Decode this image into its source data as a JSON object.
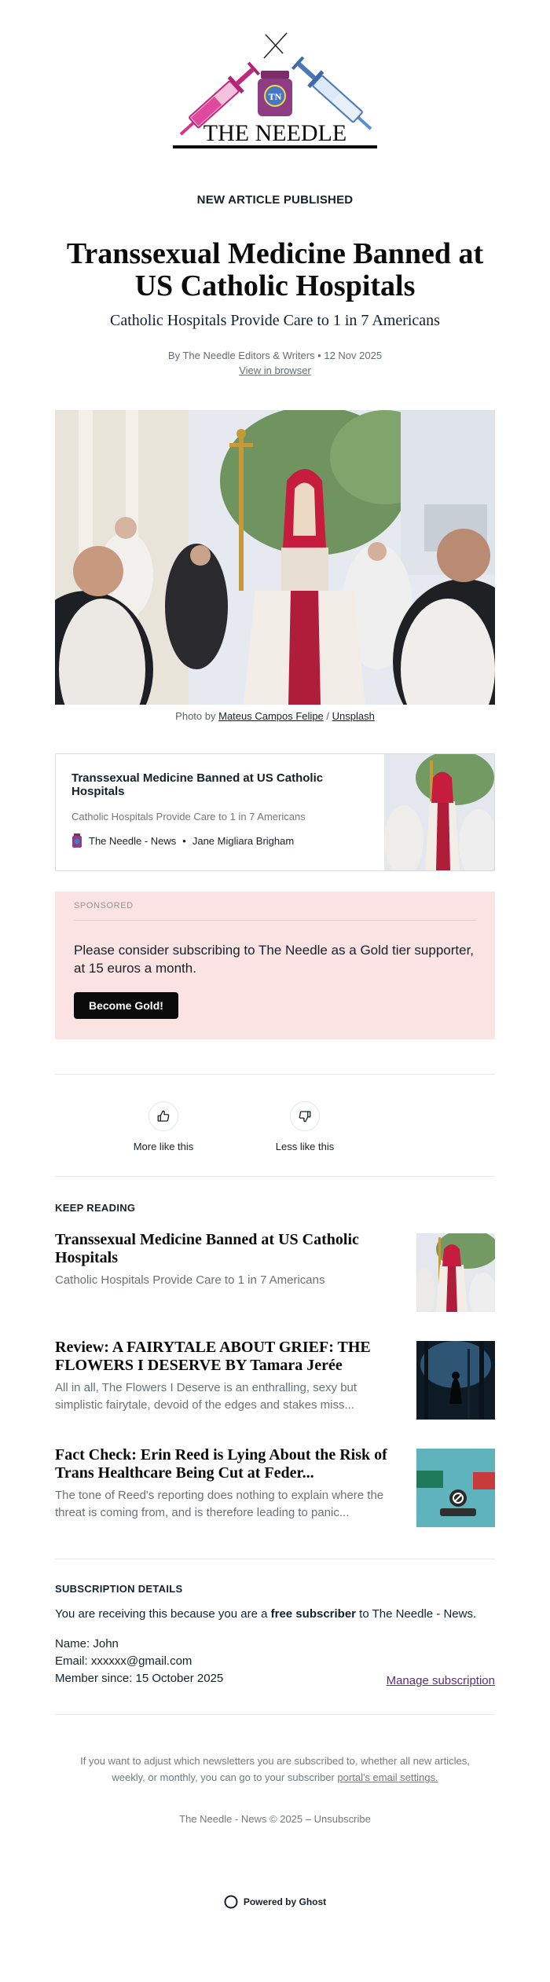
{
  "logo": {
    "text": "THE NEEDLE",
    "badge": "TN"
  },
  "email": {
    "kicker": "NEW ARTICLE PUBLISHED",
    "title": "Transsexual Medicine Banned at US Catholic Hospitals",
    "subtitle": "Catholic Hospitals Provide Care to 1 in 7 Americans",
    "byline": "By The Needle Editors & Writers • 12 Nov 2025",
    "view_in_browser": "View in browser"
  },
  "caption": {
    "prefix": "Photo by ",
    "author": "Mateus Campos Felipe",
    "sep": " / ",
    "source": "Unsplash"
  },
  "bookmark": {
    "title": "Transsexual Medicine Banned at US Catholic Hospitals",
    "description": "Catholic Hospitals Provide Care to 1 in 7 Americans",
    "publisher": "The Needle - News",
    "dot": "•",
    "author": "Jane Migliara Brigham"
  },
  "sponsored": {
    "label": "SPONSORED",
    "text": "Please consider subscribing to The Needle as a Gold tier supporter, at 15 euros a month.",
    "button": "Become Gold!"
  },
  "feedback": {
    "more": "More like this",
    "less": "Less like this"
  },
  "keep_reading": {
    "label": "KEEP READING",
    "posts": [
      {
        "title": "Transsexual Medicine Banned at US Catholic Hospitals",
        "excerpt": "Catholic Hospitals Provide Care to 1 in 7 Americans"
      },
      {
        "title": "Review: A FAIRYTALE ABOUT GRIEF: THE FLOWERS I DESERVE BY Tamara Jerée",
        "excerpt": "All in all, The Flowers I Deserve is an enthralling, sexy but simplistic fairytale, devoid of the edges and stakes miss..."
      },
      {
        "title": "Fact Check: Erin Reed is Lying About the Risk of Trans Healthcare Being Cut at Feder...",
        "excerpt": "The tone of Reed's reporting does nothing to explain where the threat is coming from, and is therefore leading to panic..."
      }
    ]
  },
  "subscription": {
    "label": "SUBSCRIPTION DETAILS",
    "intro_prefix": "You are receiving this because you are a ",
    "intro_bold": "free subscriber",
    "intro_suffix": " to The Needle - News.",
    "name": "Name: John",
    "email": "Email: xxxxxx@gmail.com",
    "member_since": "Member since: 15 October 2025",
    "manage": "Manage subscription"
  },
  "footer": {
    "text": "If you want to adjust which newsletters you are subscribed to, whether all new articles, weekly, or monthly, you can go to your subscriber ",
    "link": "portal's email settings.",
    "copyright": "The Needle - News © 2025 – ",
    "unsubscribe": "Unsubscribe",
    "powered": "Powered by Ghost"
  },
  "colors": {
    "accent": "#0b0b0b",
    "sponsored_bg": "#fbe3e3",
    "manage_link": "#5b2c7a"
  }
}
